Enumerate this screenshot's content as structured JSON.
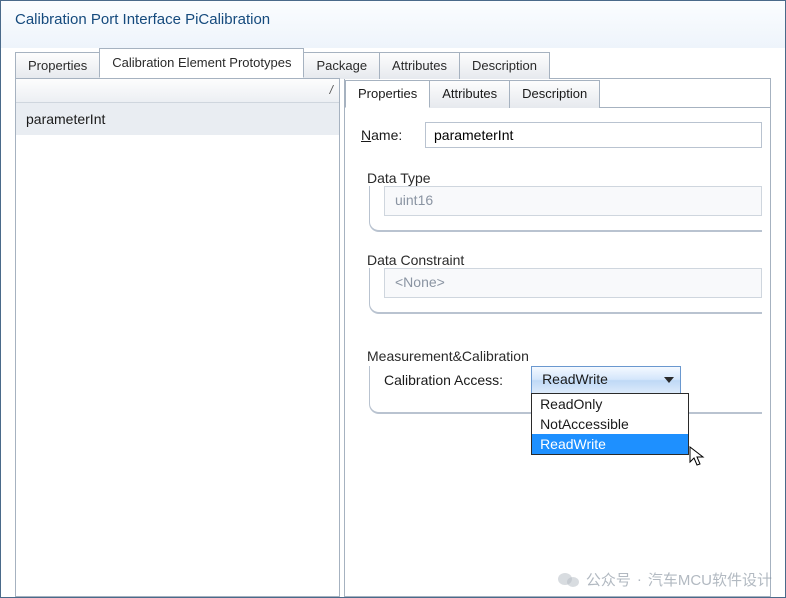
{
  "window": {
    "title": "Calibration Port Interface PiCalibration"
  },
  "outer_tabs": {
    "properties": "Properties",
    "cep": "Calibration Element Prototypes",
    "package": "Package",
    "attributes": "Attributes",
    "description": "Description"
  },
  "left": {
    "header_marker": "/",
    "items": [
      "parameterInt"
    ]
  },
  "inner_tabs": {
    "properties": "Properties",
    "attributes": "Attributes",
    "description": "Description"
  },
  "form": {
    "name_label_prefix": "N",
    "name_label_rest": "ame:",
    "name_value": "parameterInt",
    "datatype_group": "Data Type",
    "datatype_value": "uint16",
    "constraint_group": "Data Constraint",
    "constraint_value": "<None>",
    "mc_group": "Measurement&Calibration",
    "calib_access_label": "Calibration Access:",
    "calib_access_value": "ReadWrite",
    "calib_access_options": [
      "ReadOnly",
      "NotAccessible",
      "ReadWrite"
    ]
  },
  "watermark": {
    "prefix": "公众号",
    "separator": " · ",
    "name": "汽车MCU软件设计"
  }
}
